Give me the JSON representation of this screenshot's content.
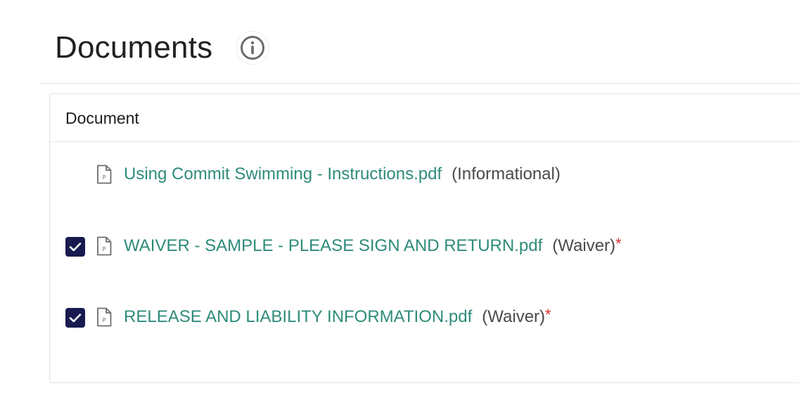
{
  "header": {
    "title": "Documents",
    "info_icon": "info-circle-icon"
  },
  "table": {
    "column_header": "Document",
    "rows": [
      {
        "checked": null,
        "file_icon": "pdf-file-icon",
        "file_name": "Using Commit Swimming - Instructions.pdf",
        "type": "(Informational)",
        "required_marker": ""
      },
      {
        "checked": true,
        "file_icon": "pdf-file-icon",
        "file_name": "WAIVER - SAMPLE - PLEASE SIGN AND RETURN.pdf",
        "type": "(Waiver)",
        "required_marker": "*"
      },
      {
        "checked": true,
        "file_icon": "pdf-file-icon",
        "file_name": "RELEASE AND LIABILITY INFORMATION.pdf",
        "type": "(Waiver)",
        "required_marker": "*"
      }
    ]
  },
  "colors": {
    "link": "#2e8b7a",
    "checkbox": "#171a4f",
    "required": "#d32f2f"
  }
}
